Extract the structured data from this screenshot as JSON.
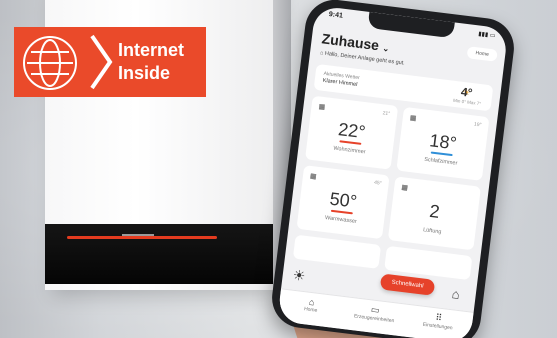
{
  "badge": {
    "line1": "Internet",
    "line2": "Inside",
    "color": "#ea4a2a",
    "icon": "globe-icon"
  },
  "app": {
    "status_time": "9:41",
    "title": "Zuhause",
    "home_button": "Home",
    "message": "Hallo, Deiner Anlage geht es gut.",
    "weather": {
      "top": "Aktuelles Wetter",
      "location": "Klarer Himmel",
      "temp": "4°",
      "range": "Min 0° Max 7°"
    },
    "tiles": [
      {
        "icon": "calendar-icon",
        "corner": "21°",
        "value": "22°",
        "label": "Wohnzimmer",
        "bar": "#e6422a"
      },
      {
        "icon": "calendar-icon",
        "corner": "19°",
        "value": "18°",
        "label": "Schlafzimmer",
        "bar": "#2f8fd8"
      },
      {
        "icon": "calendar-icon",
        "corner": "45°",
        "value": "50°",
        "label": "Warmwasser",
        "bar": "#e6422a"
      },
      {
        "icon": "calendar-icon",
        "corner": "",
        "value": "2",
        "label": "Lüftung",
        "bar": ""
      }
    ],
    "fab": "Schnellwahl",
    "nav": [
      {
        "icon": "home-icon",
        "label": "Home"
      },
      {
        "icon": "heater-icon",
        "label": "Erzeugereinheiten"
      },
      {
        "icon": "grid-icon",
        "label": "Einstellungen"
      }
    ]
  }
}
